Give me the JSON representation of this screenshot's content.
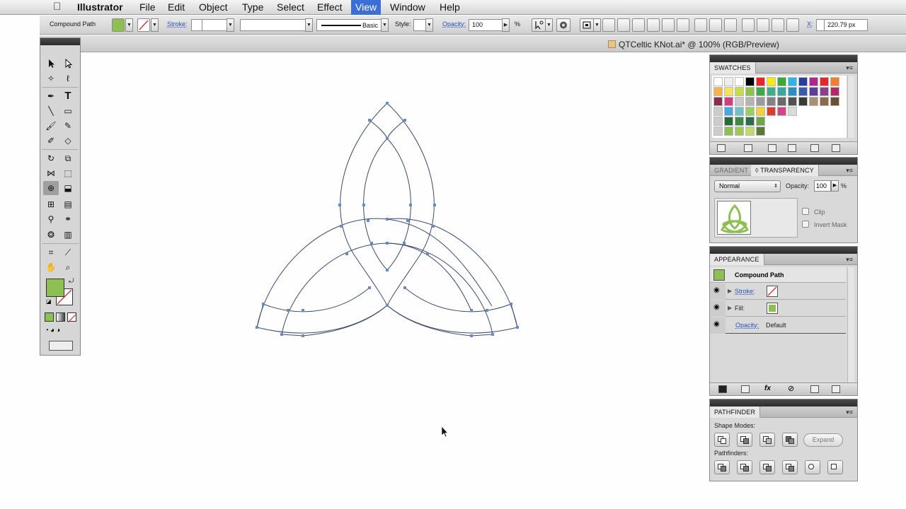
{
  "menubar": {
    "app": "Illustrator",
    "items": [
      "File",
      "Edit",
      "Object",
      "Type",
      "Select",
      "Effect",
      "View",
      "Window",
      "Help"
    ],
    "active": "View"
  },
  "control": {
    "selection_label": "Compound Path",
    "stroke_label": "Stroke:",
    "brush_label": "Basic",
    "style_label": "Style:",
    "opacity_label": "Opacity:",
    "opacity_value": "100",
    "percent": "%",
    "x_label": "X:",
    "x_value": "220.79 px"
  },
  "document": {
    "title": "QTCeltic KNot.ai* @ 100% (RGB/Preview)"
  },
  "swatches": {
    "tab": "SWATCHES"
  },
  "transparency": {
    "tabs": [
      "GRADIENT",
      "TRANSPARENCY"
    ],
    "active_tab_prefix": "◊",
    "blend_mode": "Normal",
    "opacity_label": "Opacity:",
    "opacity_value": "100",
    "percent": "%",
    "clip_label": "Clip",
    "invert_mask_label": "Invert Mask"
  },
  "appearance": {
    "tab": "APPEARANCE",
    "object": "Compound Path",
    "stroke_label": "Stroke:",
    "fill_label": "Fill:",
    "opacity_label": "Opacity:",
    "opacity_value": "Default"
  },
  "pathfinder": {
    "tab": "PATHFINDER",
    "shape_modes_label": "Shape Modes:",
    "expand_label": "Expand",
    "pathfinders_label": "Pathfinders:"
  },
  "colors": {
    "fill_green": "#8dbf53",
    "stroke_none_red": "#d23a3a",
    "path_stroke": "#3b4a6b",
    "anchor": "#6a88c4"
  }
}
